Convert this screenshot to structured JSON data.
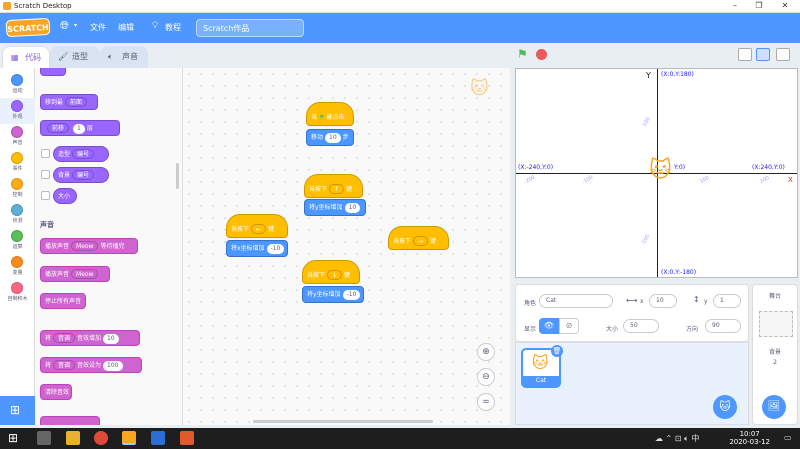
{
  "window": {
    "title": "Scratch Desktop"
  },
  "menubar": {
    "logo": "SCRATCH",
    "file": "文件",
    "edit": "编辑",
    "tutorials": "教程",
    "project_name": "Scratch作品"
  },
  "tabs": {
    "code": "代码",
    "costumes": "造型",
    "sounds": "声音"
  },
  "categories": [
    {
      "label": "运动",
      "color": "#4c97ff"
    },
    {
      "label": "外观",
      "color": "#9966ff"
    },
    {
      "label": "声音",
      "color": "#cf63cf"
    },
    {
      "label": "事件",
      "color": "#ffbf00"
    },
    {
      "label": "控制",
      "color": "#ffab19"
    },
    {
      "label": "侦测",
      "color": "#5cb1d6"
    },
    {
      "label": "运算",
      "color": "#59c059"
    },
    {
      "label": "变量",
      "color": "#ff8c1a"
    },
    {
      "label": "自制积木",
      "color": "#ff6680"
    }
  ],
  "palette": {
    "move_layer": "移到最",
    "move_layer_dd": "前面",
    "go_layers_a": "前移",
    "go_layers_n": "1",
    "go_layers_b": "层",
    "costume": "造型",
    "costume_dd": "编号",
    "backdrop": "背景",
    "backdrop_dd": "编号",
    "size": "大小",
    "sound_header": "声音",
    "play_until": "播放声音",
    "play_until_dd": "Meow",
    "play_until_tail": "等待播完",
    "start_sound": "播放声音",
    "start_sound_dd": "Meow",
    "stop_all": "停止所有声音",
    "change_effect_a": "将",
    "change_effect_dd": "音调",
    "change_effect_b": "音效增加",
    "change_effect_n": "10",
    "set_effect_a": "将",
    "set_effect_dd": "音调",
    "set_effect_b": "音效设为",
    "set_effect_n": "100",
    "clear_effects": "清除音效"
  },
  "workspace": {
    "flag_hat_a": "当",
    "flag_hat_b": "被点击",
    "move_a": "移动",
    "move_n": "10",
    "move_b": "步",
    "key_up_a": "当按下",
    "key_up_dd": "↑",
    "key_up_b": "键",
    "change_y_up": "将y坐标增加",
    "change_y_up_n": "10",
    "key_left_a": "当按下",
    "key_left_dd": "←",
    "key_left_b": "键",
    "change_x_left": "将x坐标增加",
    "change_x_left_n": "-10",
    "key_right_a": "当按下",
    "key_right_dd": "→",
    "key_right_b": "键",
    "key_down_a": "当按下",
    "key_down_dd": "↓",
    "key_down_b": "键",
    "change_y_down": "将y坐标增加",
    "change_y_down_n": "-10"
  },
  "stage": {
    "y_label": "Y",
    "top": "(X:0,Y:180)",
    "bottom": "(X:0,Y:-180)",
    "left": "(X:-240,Y:0)",
    "right": "(X:240,Y:0)",
    "center": "Y:0)",
    "x_axis": "X",
    "xnums": [
      "-200",
      "-100",
      "100",
      "200"
    ],
    "ynums": [
      "100",
      "-100"
    ]
  },
  "sprite_info": {
    "sprite_label": "角色",
    "sprite_name": "Cat",
    "x_label": "x",
    "x_value": "10",
    "y_label": "y",
    "y_value": "1",
    "show_label": "显示",
    "size_label": "大小",
    "size_value": "50",
    "direction_label": "方向",
    "direction_value": "90"
  },
  "sprite_list": {
    "cat_name": "Cat"
  },
  "stage_panel": {
    "title": "舞台",
    "backdrop_label": "背景",
    "backdrop_count": "2"
  },
  "taskbar": {
    "time": "10:07",
    "date": "2020-03-12"
  }
}
